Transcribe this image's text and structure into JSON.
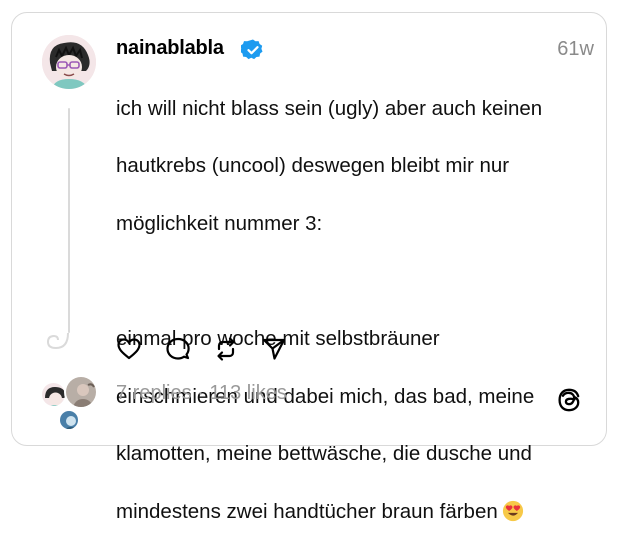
{
  "post": {
    "username": "nainablabla",
    "timestamp": "61w",
    "verified_icon": "verified-badge-icon",
    "text_lines": [
      "ich will nicht blass sein (ugly) aber auch keinen",
      "hautkrebs (uncool) deswegen bleibt mir nur",
      "möglichkeit nummer 3:",
      "",
      "einmal pro woche mit selbstbräuner",
      "einschmieren und dabei mich, das bad, meine",
      "klamotten, meine bettwäsche, die dusche und",
      "mindestens zwei handtücher braun färben"
    ],
    "emoji": "heart-eyes-emoji"
  },
  "actions": {
    "icons": [
      "heart-icon",
      "comment-icon",
      "repost-icon",
      "share-icon"
    ]
  },
  "footer": {
    "stats": "7 replies · 113 likes",
    "logo_icon": "threads-logo-icon"
  },
  "colors": {
    "verified": "#1d9bf0",
    "text": "#101010",
    "muted": "#999999",
    "border": "#d9d9d9"
  }
}
